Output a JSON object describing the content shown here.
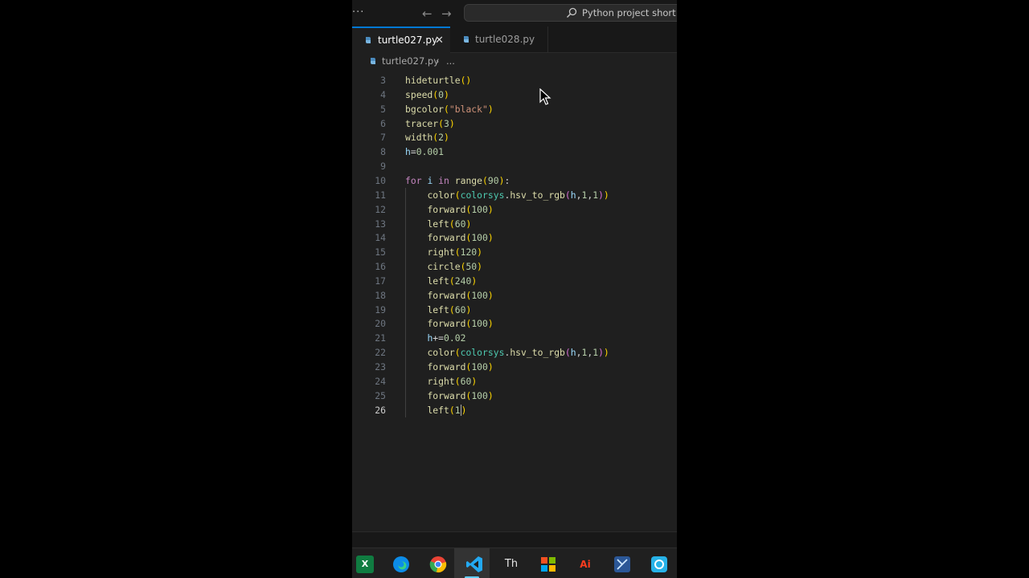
{
  "title_bar": {
    "menu_icon": "ellipsis-icon",
    "back_icon": "arrow-left-icon",
    "forward_icon": "arrow-right-icon",
    "search_text": "Python project short vid"
  },
  "tabs": [
    {
      "label": "turtle027.py",
      "active": true,
      "icon": "python-file-icon"
    },
    {
      "label": "turtle028.py",
      "active": false,
      "icon": "python-file-icon"
    }
  ],
  "breadcrumb": {
    "file": "turtle027.py",
    "more": "..."
  },
  "editor": {
    "active_line": 26,
    "lines": [
      {
        "n": "3",
        "indent": false,
        "parts": [
          {
            "t": "hideturtle",
            "c": "fn"
          },
          {
            "t": "()",
            "c": "p1"
          }
        ]
      },
      {
        "n": "4",
        "indent": false,
        "parts": [
          {
            "t": "speed",
            "c": "fn"
          },
          {
            "t": "(",
            "c": "p1"
          },
          {
            "t": "0",
            "c": "num"
          },
          {
            "t": ")",
            "c": "p1"
          }
        ]
      },
      {
        "n": "5",
        "indent": false,
        "parts": [
          {
            "t": "bgcolor",
            "c": "fn"
          },
          {
            "t": "(",
            "c": "p1"
          },
          {
            "t": "\"black\"",
            "c": "str"
          },
          {
            "t": ")",
            "c": "p1"
          }
        ]
      },
      {
        "n": "6",
        "indent": false,
        "parts": [
          {
            "t": "tracer",
            "c": "fn"
          },
          {
            "t": "(",
            "c": "p1"
          },
          {
            "t": "3",
            "c": "num"
          },
          {
            "t": ")",
            "c": "p1"
          }
        ]
      },
      {
        "n": "7",
        "indent": false,
        "parts": [
          {
            "t": "width",
            "c": "fn"
          },
          {
            "t": "(",
            "c": "p1"
          },
          {
            "t": "2",
            "c": "num"
          },
          {
            "t": ")",
            "c": "p1"
          }
        ]
      },
      {
        "n": "8",
        "indent": false,
        "parts": [
          {
            "t": "h",
            "c": "var"
          },
          {
            "t": "=",
            "c": "op"
          },
          {
            "t": "0.001",
            "c": "num"
          }
        ]
      },
      {
        "n": "9",
        "indent": false,
        "parts": []
      },
      {
        "n": "10",
        "indent": false,
        "parts": [
          {
            "t": "for",
            "c": "kw"
          },
          {
            "t": " ",
            "c": "op"
          },
          {
            "t": "i",
            "c": "var"
          },
          {
            "t": " ",
            "c": "op"
          },
          {
            "t": "in",
            "c": "kw"
          },
          {
            "t": " ",
            "c": "op"
          },
          {
            "t": "range",
            "c": "fn"
          },
          {
            "t": "(",
            "c": "p1"
          },
          {
            "t": "90",
            "c": "num"
          },
          {
            "t": ")",
            "c": "p1"
          },
          {
            "t": ":",
            "c": "op"
          }
        ]
      },
      {
        "n": "11",
        "indent": true,
        "parts": [
          {
            "t": "color",
            "c": "fn"
          },
          {
            "t": "(",
            "c": "p1"
          },
          {
            "t": "colorsys",
            "c": "mod"
          },
          {
            "t": ".",
            "c": "op"
          },
          {
            "t": "hsv_to_rgb",
            "c": "fn"
          },
          {
            "t": "(",
            "c": "p2"
          },
          {
            "t": "h",
            "c": "var"
          },
          {
            "t": ",",
            "c": "op"
          },
          {
            "t": "1",
            "c": "num"
          },
          {
            "t": ",",
            "c": "op"
          },
          {
            "t": "1",
            "c": "num"
          },
          {
            "t": ")",
            "c": "p2"
          },
          {
            "t": ")",
            "c": "p1"
          }
        ]
      },
      {
        "n": "12",
        "indent": true,
        "parts": [
          {
            "t": "forward",
            "c": "fn"
          },
          {
            "t": "(",
            "c": "p1"
          },
          {
            "t": "100",
            "c": "num"
          },
          {
            "t": ")",
            "c": "p1"
          }
        ]
      },
      {
        "n": "13",
        "indent": true,
        "parts": [
          {
            "t": "left",
            "c": "fn"
          },
          {
            "t": "(",
            "c": "p1"
          },
          {
            "t": "60",
            "c": "num"
          },
          {
            "t": ")",
            "c": "p1"
          }
        ]
      },
      {
        "n": "14",
        "indent": true,
        "parts": [
          {
            "t": "forward",
            "c": "fn"
          },
          {
            "t": "(",
            "c": "p1"
          },
          {
            "t": "100",
            "c": "num"
          },
          {
            "t": ")",
            "c": "p1"
          }
        ]
      },
      {
        "n": "15",
        "indent": true,
        "parts": [
          {
            "t": "right",
            "c": "fn"
          },
          {
            "t": "(",
            "c": "p1"
          },
          {
            "t": "120",
            "c": "num"
          },
          {
            "t": ")",
            "c": "p1"
          }
        ]
      },
      {
        "n": "16",
        "indent": true,
        "parts": [
          {
            "t": "circle",
            "c": "fn"
          },
          {
            "t": "(",
            "c": "p1"
          },
          {
            "t": "50",
            "c": "num"
          },
          {
            "t": ")",
            "c": "p1"
          }
        ]
      },
      {
        "n": "17",
        "indent": true,
        "parts": [
          {
            "t": "left",
            "c": "fn"
          },
          {
            "t": "(",
            "c": "p1"
          },
          {
            "t": "240",
            "c": "num"
          },
          {
            "t": ")",
            "c": "p1"
          }
        ]
      },
      {
        "n": "18",
        "indent": true,
        "parts": [
          {
            "t": "forward",
            "c": "fn"
          },
          {
            "t": "(",
            "c": "p1"
          },
          {
            "t": "100",
            "c": "num"
          },
          {
            "t": ")",
            "c": "p1"
          }
        ]
      },
      {
        "n": "19",
        "indent": true,
        "parts": [
          {
            "t": "left",
            "c": "fn"
          },
          {
            "t": "(",
            "c": "p1"
          },
          {
            "t": "60",
            "c": "num"
          },
          {
            "t": ")",
            "c": "p1"
          }
        ]
      },
      {
        "n": "20",
        "indent": true,
        "parts": [
          {
            "t": "forward",
            "c": "fn"
          },
          {
            "t": "(",
            "c": "p1"
          },
          {
            "t": "100",
            "c": "num"
          },
          {
            "t": ")",
            "c": "p1"
          }
        ]
      },
      {
        "n": "21",
        "indent": true,
        "parts": [
          {
            "t": "h",
            "c": "var"
          },
          {
            "t": "+=",
            "c": "op"
          },
          {
            "t": "0.02",
            "c": "num"
          }
        ]
      },
      {
        "n": "22",
        "indent": true,
        "parts": [
          {
            "t": "color",
            "c": "fn"
          },
          {
            "t": "(",
            "c": "p1"
          },
          {
            "t": "colorsys",
            "c": "mod"
          },
          {
            "t": ".",
            "c": "op"
          },
          {
            "t": "hsv_to_rgb",
            "c": "fn"
          },
          {
            "t": "(",
            "c": "p2"
          },
          {
            "t": "h",
            "c": "var"
          },
          {
            "t": ",",
            "c": "op"
          },
          {
            "t": "1",
            "c": "num"
          },
          {
            "t": ",",
            "c": "op"
          },
          {
            "t": "1",
            "c": "num"
          },
          {
            "t": ")",
            "c": "p2"
          },
          {
            "t": ")",
            "c": "p1"
          }
        ]
      },
      {
        "n": "23",
        "indent": true,
        "parts": [
          {
            "t": "forward",
            "c": "fn"
          },
          {
            "t": "(",
            "c": "p1"
          },
          {
            "t": "100",
            "c": "num"
          },
          {
            "t": ")",
            "c": "p1"
          }
        ]
      },
      {
        "n": "24",
        "indent": true,
        "parts": [
          {
            "t": "right",
            "c": "fn"
          },
          {
            "t": "(",
            "c": "p1"
          },
          {
            "t": "60",
            "c": "num"
          },
          {
            "t": ")",
            "c": "p1"
          }
        ]
      },
      {
        "n": "25",
        "indent": true,
        "parts": [
          {
            "t": "forward",
            "c": "fn"
          },
          {
            "t": "(",
            "c": "p1"
          },
          {
            "t": "100",
            "c": "num"
          },
          {
            "t": ")",
            "c": "p1"
          }
        ]
      },
      {
        "n": "26",
        "indent": true,
        "parts": [
          {
            "t": "left",
            "c": "fn"
          },
          {
            "t": "(",
            "c": "p1"
          },
          {
            "t": "1",
            "c": "num"
          },
          {
            "t": ")",
            "c": "p1"
          }
        ]
      }
    ]
  },
  "taskbar": {
    "excel_label": "X",
    "adobe_label": "Ai",
    "typora_label": "Th",
    "apps": [
      "excel-icon",
      "edge-icon",
      "chrome-icon",
      "vscode-icon",
      "typora-icon",
      "office-icon",
      "illustrator-icon",
      "snipping-icon",
      "screen-recorder-icon"
    ]
  },
  "colors": {
    "accent": "#0078d4",
    "editor_bg": "#1f1f1f",
    "chrome_bg": "#181818"
  }
}
